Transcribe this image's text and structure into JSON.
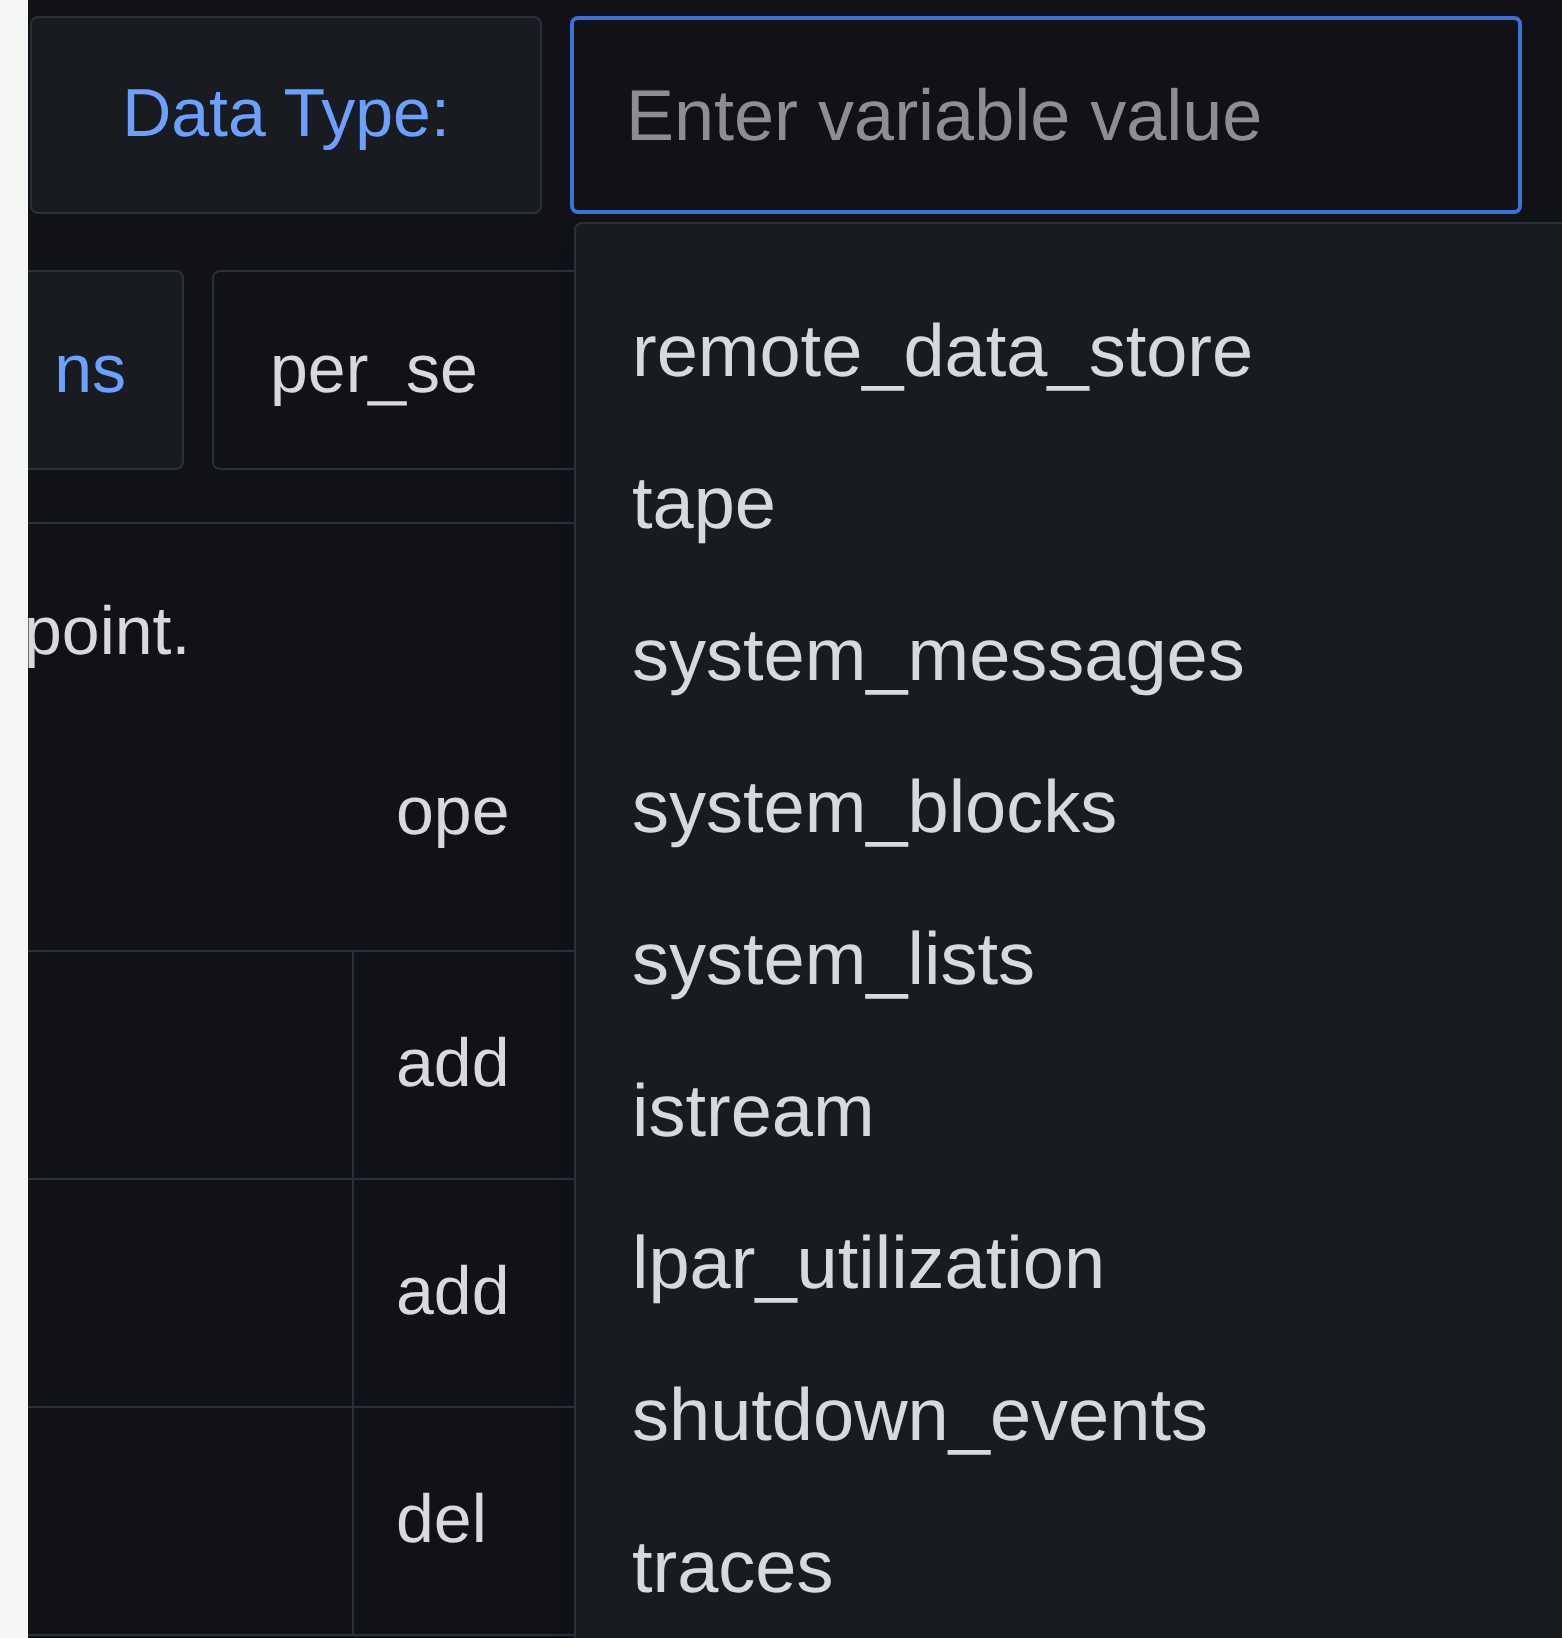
{
  "variable_row": {
    "label": "Data Type:",
    "input": {
      "placeholder": "Enter variable value",
      "focused": true
    }
  },
  "second_row": {
    "button": "ns",
    "field": "per_se"
  },
  "description": "point.",
  "table": {
    "header": "ope",
    "rows": [
      "add",
      "add",
      "del"
    ]
  },
  "dropdown": {
    "options": [
      {
        "label": "remote_data_store"
      },
      {
        "label": "tape"
      },
      {
        "label": "system_messages"
      },
      {
        "label": "system_blocks"
      },
      {
        "label": "system_lists"
      },
      {
        "label": "istream"
      },
      {
        "label": "lpar_utilization"
      },
      {
        "label": "shutdown_events"
      },
      {
        "label": "traces"
      }
    ]
  }
}
